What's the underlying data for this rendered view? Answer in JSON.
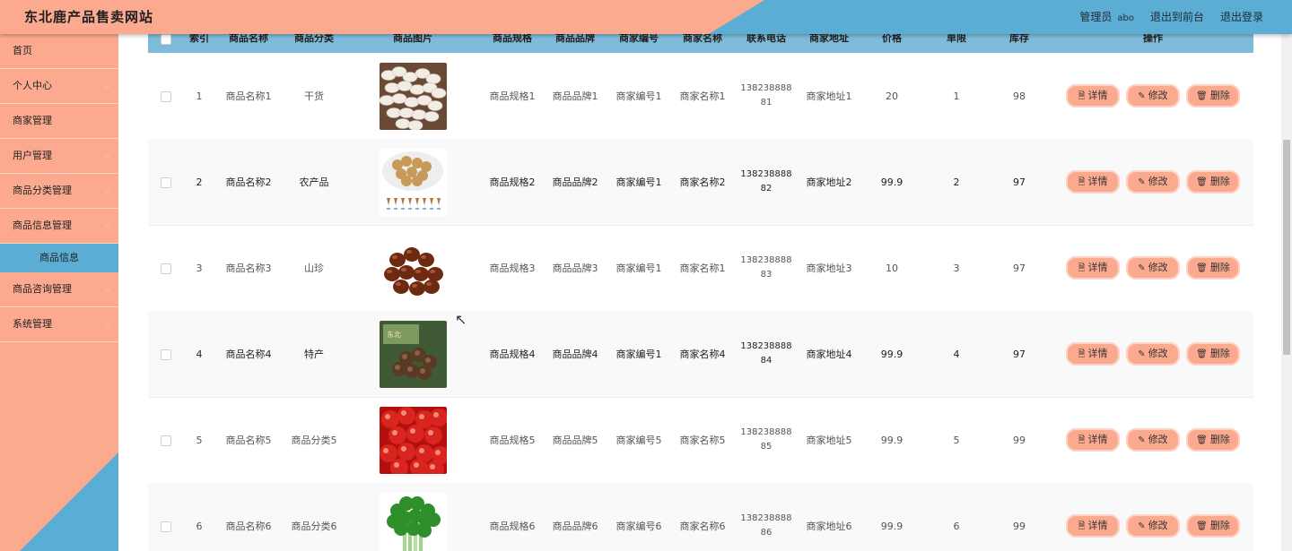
{
  "header": {
    "title": "东北鹿产品售卖网站",
    "user_role": "管理员",
    "user_name": "abo",
    "to_frontend": "退出到前台",
    "logout": "退出登录"
  },
  "sidebar": {
    "items": [
      {
        "label": "首页",
        "expandable": false
      },
      {
        "label": "个人中心",
        "expandable": true
      },
      {
        "label": "商家管理",
        "expandable": true
      },
      {
        "label": "用户管理",
        "expandable": true
      },
      {
        "label": "商品分类管理",
        "expandable": true
      },
      {
        "label": "商品信息管理",
        "expandable": true
      },
      {
        "label": "商品信息",
        "expandable": false,
        "active": true
      },
      {
        "label": "商品咨询管理",
        "expandable": true
      },
      {
        "label": "系统管理",
        "expandable": true
      }
    ]
  },
  "table": {
    "columns": [
      "索引",
      "商品名称",
      "商品分类",
      "商品图片",
      "商品规格",
      "商品品牌",
      "商家编号",
      "商家名称",
      "联系电话",
      "商家地址",
      "价格",
      "单限",
      "库存",
      "操作"
    ],
    "buttons": {
      "detail": "详情",
      "edit": "修改",
      "delete": "删除"
    },
    "rows": [
      {
        "index": "1",
        "name": "商品名称1",
        "category": "干货",
        "image": "beans",
        "spec": "商品规格1",
        "brand": "商品品牌1",
        "merchant_no": "商家编号1",
        "merchant_name": "商家名称1",
        "phone": "13823888881",
        "address": "商家地址1",
        "price": "20",
        "limit": "1",
        "stock": "98"
      },
      {
        "index": "2",
        "name": "商品名称2",
        "category": "农产品",
        "image": "nuts",
        "spec": "商品规格2",
        "brand": "商品品牌2",
        "merchant_no": "商家编号1",
        "merchant_name": "商家名称2",
        "phone": "13823888882",
        "address": "商家地址2",
        "price": "99.9",
        "limit": "2",
        "stock": "97"
      },
      {
        "index": "3",
        "name": "商品名称3",
        "category": "山珍",
        "image": "chestnuts",
        "spec": "商品规格3",
        "brand": "商品品牌3",
        "merchant_no": "商家编号1",
        "merchant_name": "商家名称1",
        "phone": "13823888883",
        "address": "商家地址3",
        "price": "10",
        "limit": "3",
        "stock": "97"
      },
      {
        "index": "4",
        "name": "商品名称4",
        "category": "特产",
        "image": "mushroom-pack",
        "spec": "商品规格4",
        "brand": "商品品牌4",
        "merchant_no": "商家编号1",
        "merchant_name": "商家名称4",
        "phone": "13823888884",
        "address": "商家地址4",
        "price": "99.9",
        "limit": "4",
        "stock": "97"
      },
      {
        "index": "5",
        "name": "商品名称5",
        "category": "商品分类5",
        "image": "cherries",
        "spec": "商品规格5",
        "brand": "商品品牌5",
        "merchant_no": "商家编号5",
        "merchant_name": "商家名称5",
        "phone": "13823888885",
        "address": "商家地址5",
        "price": "99.9",
        "limit": "5",
        "stock": "99"
      },
      {
        "index": "6",
        "name": "商品名称6",
        "category": "商品分类6",
        "image": "celery",
        "spec": "商品规格6",
        "brand": "商品品牌6",
        "merchant_no": "商家编号6",
        "merchant_name": "商家名称6",
        "phone": "13823888886",
        "address": "商家地址6",
        "price": "99.9",
        "limit": "6",
        "stock": "99"
      }
    ]
  },
  "colors": {
    "salmon": "#fcaa8f",
    "blue": "#5badd4",
    "table_header": "#7ebbdb"
  }
}
